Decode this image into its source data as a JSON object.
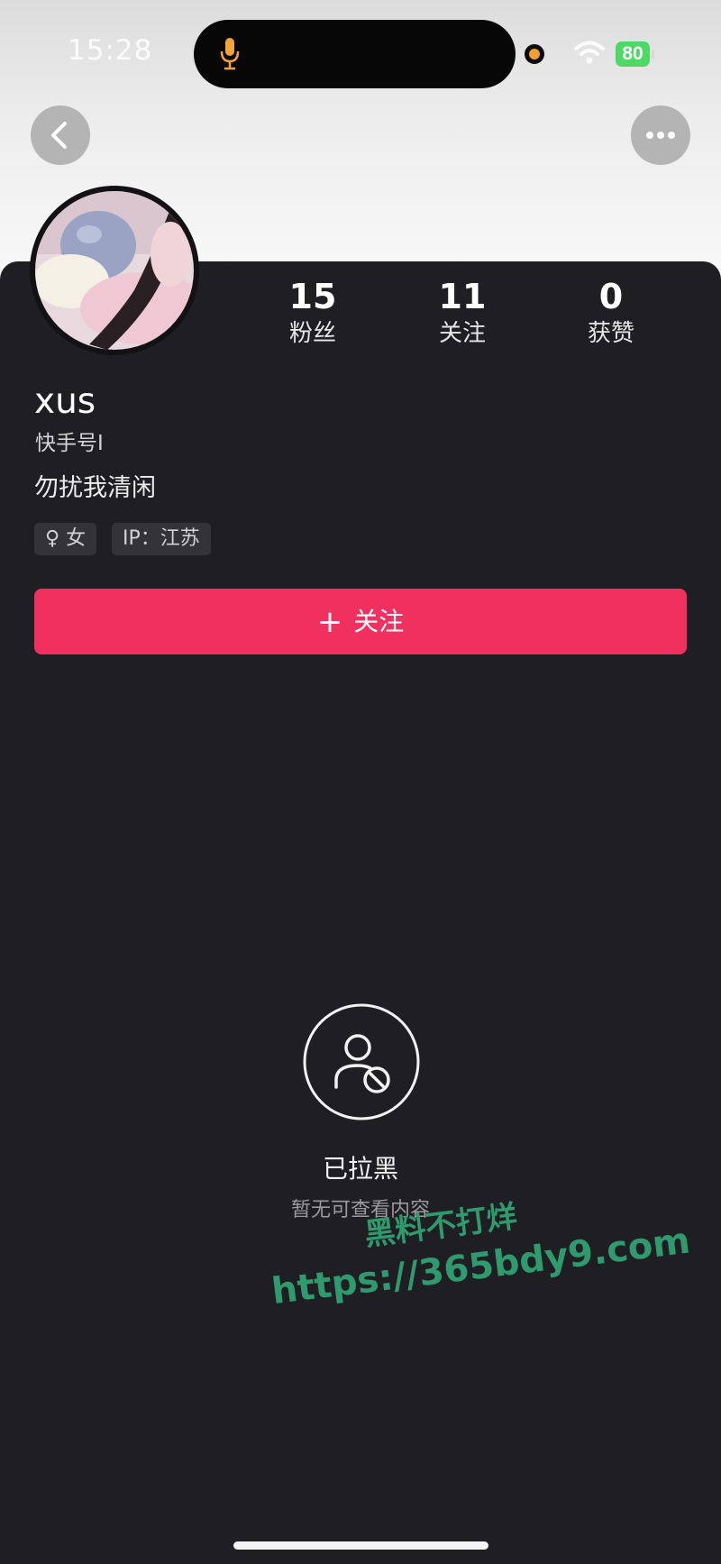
{
  "status_bar": {
    "time": "15:28",
    "battery": "80",
    "icons": [
      "microphone-icon",
      "camera-indicator-icon",
      "wifi-icon",
      "battery-icon"
    ]
  },
  "nav": {
    "back_icon": "chevron-left-icon",
    "more_icon": "ellipsis-icon"
  },
  "profile": {
    "username": "xus",
    "kuaishou_id": "快手号Ⅰ",
    "bio": "勿扰我清闲",
    "tags": {
      "gender": "♀ 女",
      "ip": "IP：江苏"
    },
    "stats": [
      {
        "value": "15",
        "label": "粉丝"
      },
      {
        "value": "11",
        "label": "关注"
      },
      {
        "value": "0",
        "label": "获赞"
      }
    ]
  },
  "follow_button": {
    "icon": "+",
    "label": "关注"
  },
  "blocked_state": {
    "icon": "user-blocked-icon",
    "title": "已拉黑",
    "subtitle": "暂无可查看内容"
  },
  "watermark": {
    "title": "黑料不打烊",
    "url": "https://365bdy9.com"
  },
  "colors": {
    "background": "#1f1e23",
    "accent": "#f0305e",
    "tag_bg": "#34333a",
    "watermark": "#2e9a6e"
  }
}
